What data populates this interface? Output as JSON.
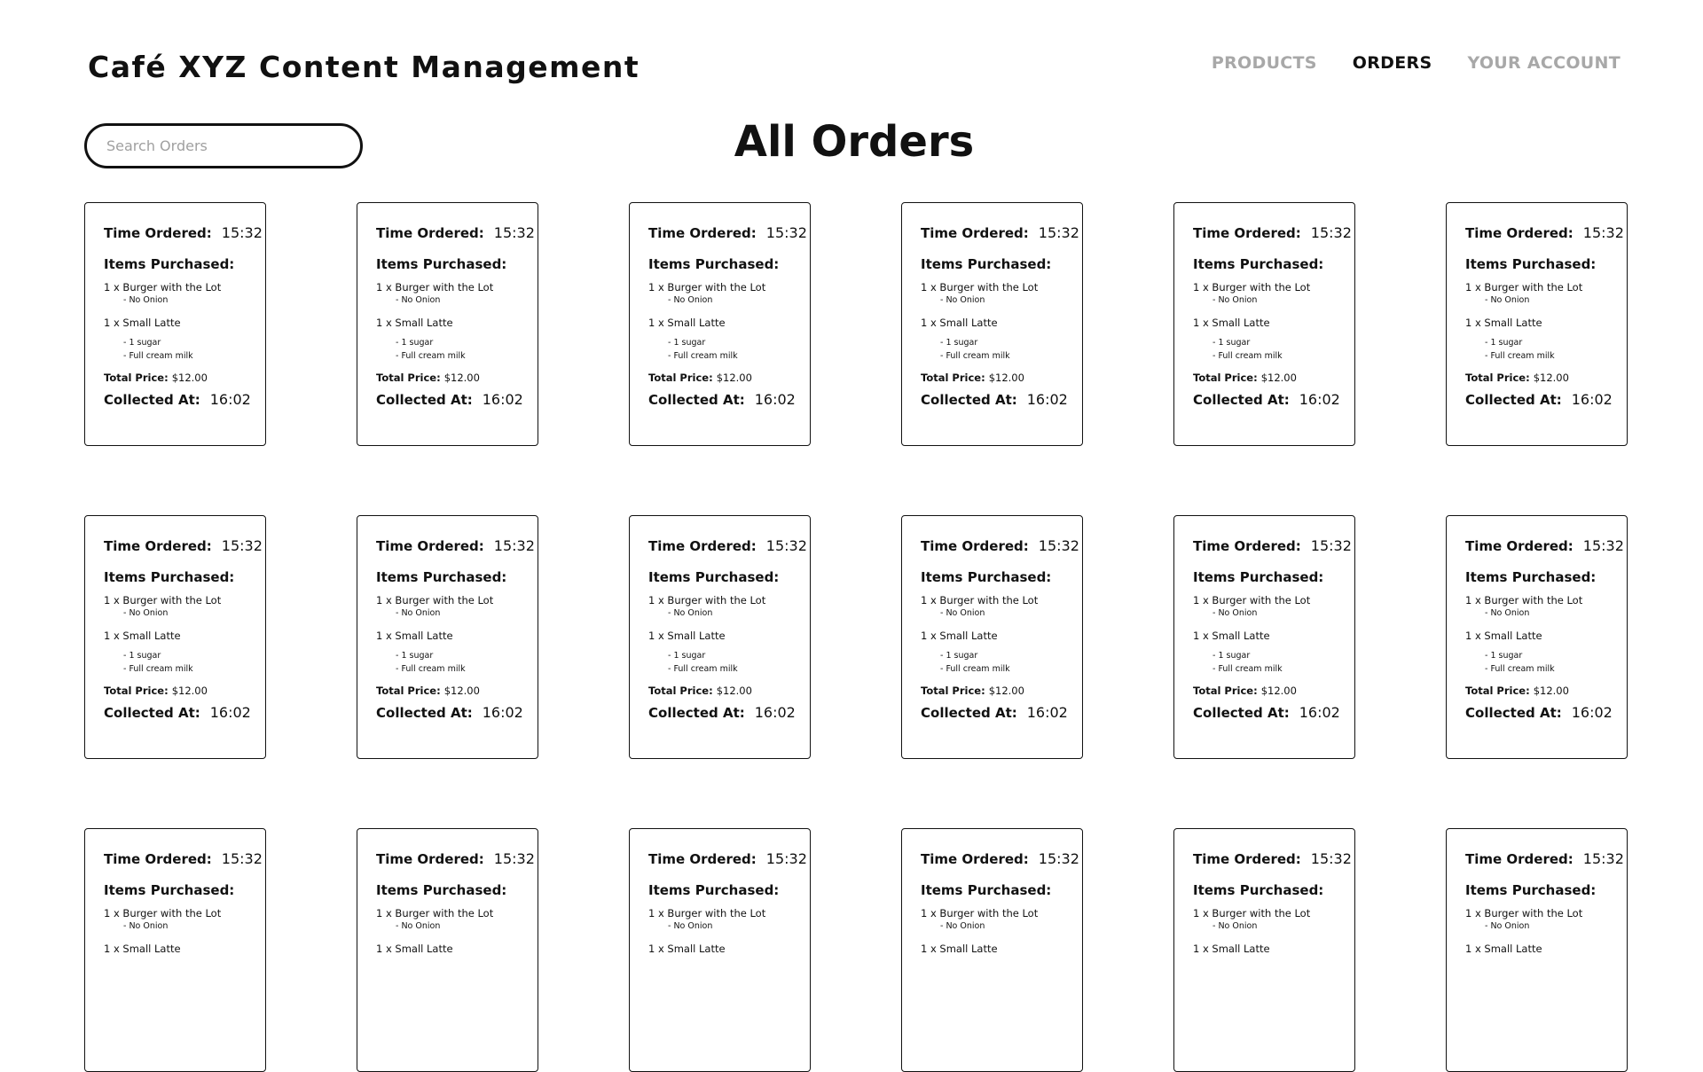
{
  "header": {
    "title": "Café XYZ Content Management",
    "nav": [
      {
        "label": "PRODUCTS",
        "active": false
      },
      {
        "label": "ORDERS",
        "active": true
      },
      {
        "label": "YOUR ACCOUNT",
        "active": false
      }
    ]
  },
  "search": {
    "placeholder": "Search Orders",
    "value": ""
  },
  "page": {
    "heading": "All Orders"
  },
  "labels": {
    "time_ordered": "Time Ordered:",
    "items_purchased": "Items Purchased:",
    "total_price": "Total Price:",
    "collected_at": "Collected At:"
  },
  "orders": [
    {
      "time_ordered": "15:32",
      "items": [
        {
          "text": "1 x Burger with the Lot",
          "modifiers": [
            "- No Onion"
          ]
        },
        {
          "text": "1 x Small Latte",
          "modifiers": [
            "- 1 sugar",
            "- Full cream milk"
          ]
        }
      ],
      "total_price": "$12.00",
      "collected_at": "16:02"
    },
    {
      "time_ordered": "15:32",
      "items": [
        {
          "text": "1 x Burger with the Lot",
          "modifiers": [
            "- No Onion"
          ]
        },
        {
          "text": "1 x Small Latte",
          "modifiers": [
            "- 1 sugar",
            "- Full cream milk"
          ]
        }
      ],
      "total_price": "$12.00",
      "collected_at": "16:02"
    },
    {
      "time_ordered": "15:32",
      "items": [
        {
          "text": "1 x Burger with the Lot",
          "modifiers": [
            "- No Onion"
          ]
        },
        {
          "text": "1 x Small Latte",
          "modifiers": [
            "- 1 sugar",
            "- Full cream milk"
          ]
        }
      ],
      "total_price": "$12.00",
      "collected_at": "16:02"
    },
    {
      "time_ordered": "15:32",
      "items": [
        {
          "text": "1 x Burger with the Lot",
          "modifiers": [
            "- No Onion"
          ]
        },
        {
          "text": "1 x Small Latte",
          "modifiers": [
            "- 1 sugar",
            "- Full cream milk"
          ]
        }
      ],
      "total_price": "$12.00",
      "collected_at": "16:02"
    },
    {
      "time_ordered": "15:32",
      "items": [
        {
          "text": "1 x Burger with the Lot",
          "modifiers": [
            "- No Onion"
          ]
        },
        {
          "text": "1 x Small Latte",
          "modifiers": [
            "- 1 sugar",
            "- Full cream milk"
          ]
        }
      ],
      "total_price": "$12.00",
      "collected_at": "16:02"
    },
    {
      "time_ordered": "15:32",
      "items": [
        {
          "text": "1 x Burger with the Lot",
          "modifiers": [
            "- No Onion"
          ]
        },
        {
          "text": "1 x Small Latte",
          "modifiers": [
            "- 1 sugar",
            "- Full cream milk"
          ]
        }
      ],
      "total_price": "$12.00",
      "collected_at": "16:02"
    },
    {
      "time_ordered": "15:32",
      "items": [
        {
          "text": "1 x Burger with the Lot",
          "modifiers": [
            "- No Onion"
          ]
        },
        {
          "text": "1 x Small Latte",
          "modifiers": [
            "- 1 sugar",
            "- Full cream milk"
          ]
        }
      ],
      "total_price": "$12.00",
      "collected_at": "16:02"
    },
    {
      "time_ordered": "15:32",
      "items": [
        {
          "text": "1 x Burger with the Lot",
          "modifiers": [
            "- No Onion"
          ]
        },
        {
          "text": "1 x Small Latte",
          "modifiers": [
            "- 1 sugar",
            "- Full cream milk"
          ]
        }
      ],
      "total_price": "$12.00",
      "collected_at": "16:02"
    },
    {
      "time_ordered": "15:32",
      "items": [
        {
          "text": "1 x Burger with the Lot",
          "modifiers": [
            "- No Onion"
          ]
        },
        {
          "text": "1 x Small Latte",
          "modifiers": [
            "- 1 sugar",
            "- Full cream milk"
          ]
        }
      ],
      "total_price": "$12.00",
      "collected_at": "16:02"
    },
    {
      "time_ordered": "15:32",
      "items": [
        {
          "text": "1 x Burger with the Lot",
          "modifiers": [
            "- No Onion"
          ]
        },
        {
          "text": "1 x Small Latte",
          "modifiers": [
            "- 1 sugar",
            "- Full cream milk"
          ]
        }
      ],
      "total_price": "$12.00",
      "collected_at": "16:02"
    },
    {
      "time_ordered": "15:32",
      "items": [
        {
          "text": "1 x Burger with the Lot",
          "modifiers": [
            "- No Onion"
          ]
        },
        {
          "text": "1 x Small Latte",
          "modifiers": [
            "- 1 sugar",
            "- Full cream milk"
          ]
        }
      ],
      "total_price": "$12.00",
      "collected_at": "16:02"
    },
    {
      "time_ordered": "15:32",
      "items": [
        {
          "text": "1 x Burger with the Lot",
          "modifiers": [
            "- No Onion"
          ]
        },
        {
          "text": "1 x Small Latte",
          "modifiers": [
            "- 1 sugar",
            "- Full cream milk"
          ]
        }
      ],
      "total_price": "$12.00",
      "collected_at": "16:02"
    },
    {
      "time_ordered": "15:32",
      "items": [
        {
          "text": "1 x Burger with the Lot",
          "modifiers": [
            "- No Onion"
          ]
        },
        {
          "text": "1 x Small Latte",
          "modifiers": []
        }
      ]
    },
    {
      "time_ordered": "15:32",
      "items": [
        {
          "text": "1 x Burger with the Lot",
          "modifiers": [
            "- No Onion"
          ]
        },
        {
          "text": "1 x Small Latte",
          "modifiers": []
        }
      ]
    },
    {
      "time_ordered": "15:32",
      "items": [
        {
          "text": "1 x Burger with the Lot",
          "modifiers": [
            "- No Onion"
          ]
        },
        {
          "text": "1 x Small Latte",
          "modifiers": []
        }
      ]
    },
    {
      "time_ordered": "15:32",
      "items": [
        {
          "text": "1 x Burger with the Lot",
          "modifiers": [
            "- No Onion"
          ]
        },
        {
          "text": "1 x Small Latte",
          "modifiers": []
        }
      ]
    },
    {
      "time_ordered": "15:32",
      "items": [
        {
          "text": "1 x Burger with the Lot",
          "modifiers": [
            "- No Onion"
          ]
        },
        {
          "text": "1 x Small Latte",
          "modifiers": []
        }
      ]
    },
    {
      "time_ordered": "15:32",
      "items": [
        {
          "text": "1 x Burger with the Lot",
          "modifiers": [
            "- No Onion"
          ]
        },
        {
          "text": "1 x Small Latte",
          "modifiers": []
        }
      ]
    }
  ]
}
